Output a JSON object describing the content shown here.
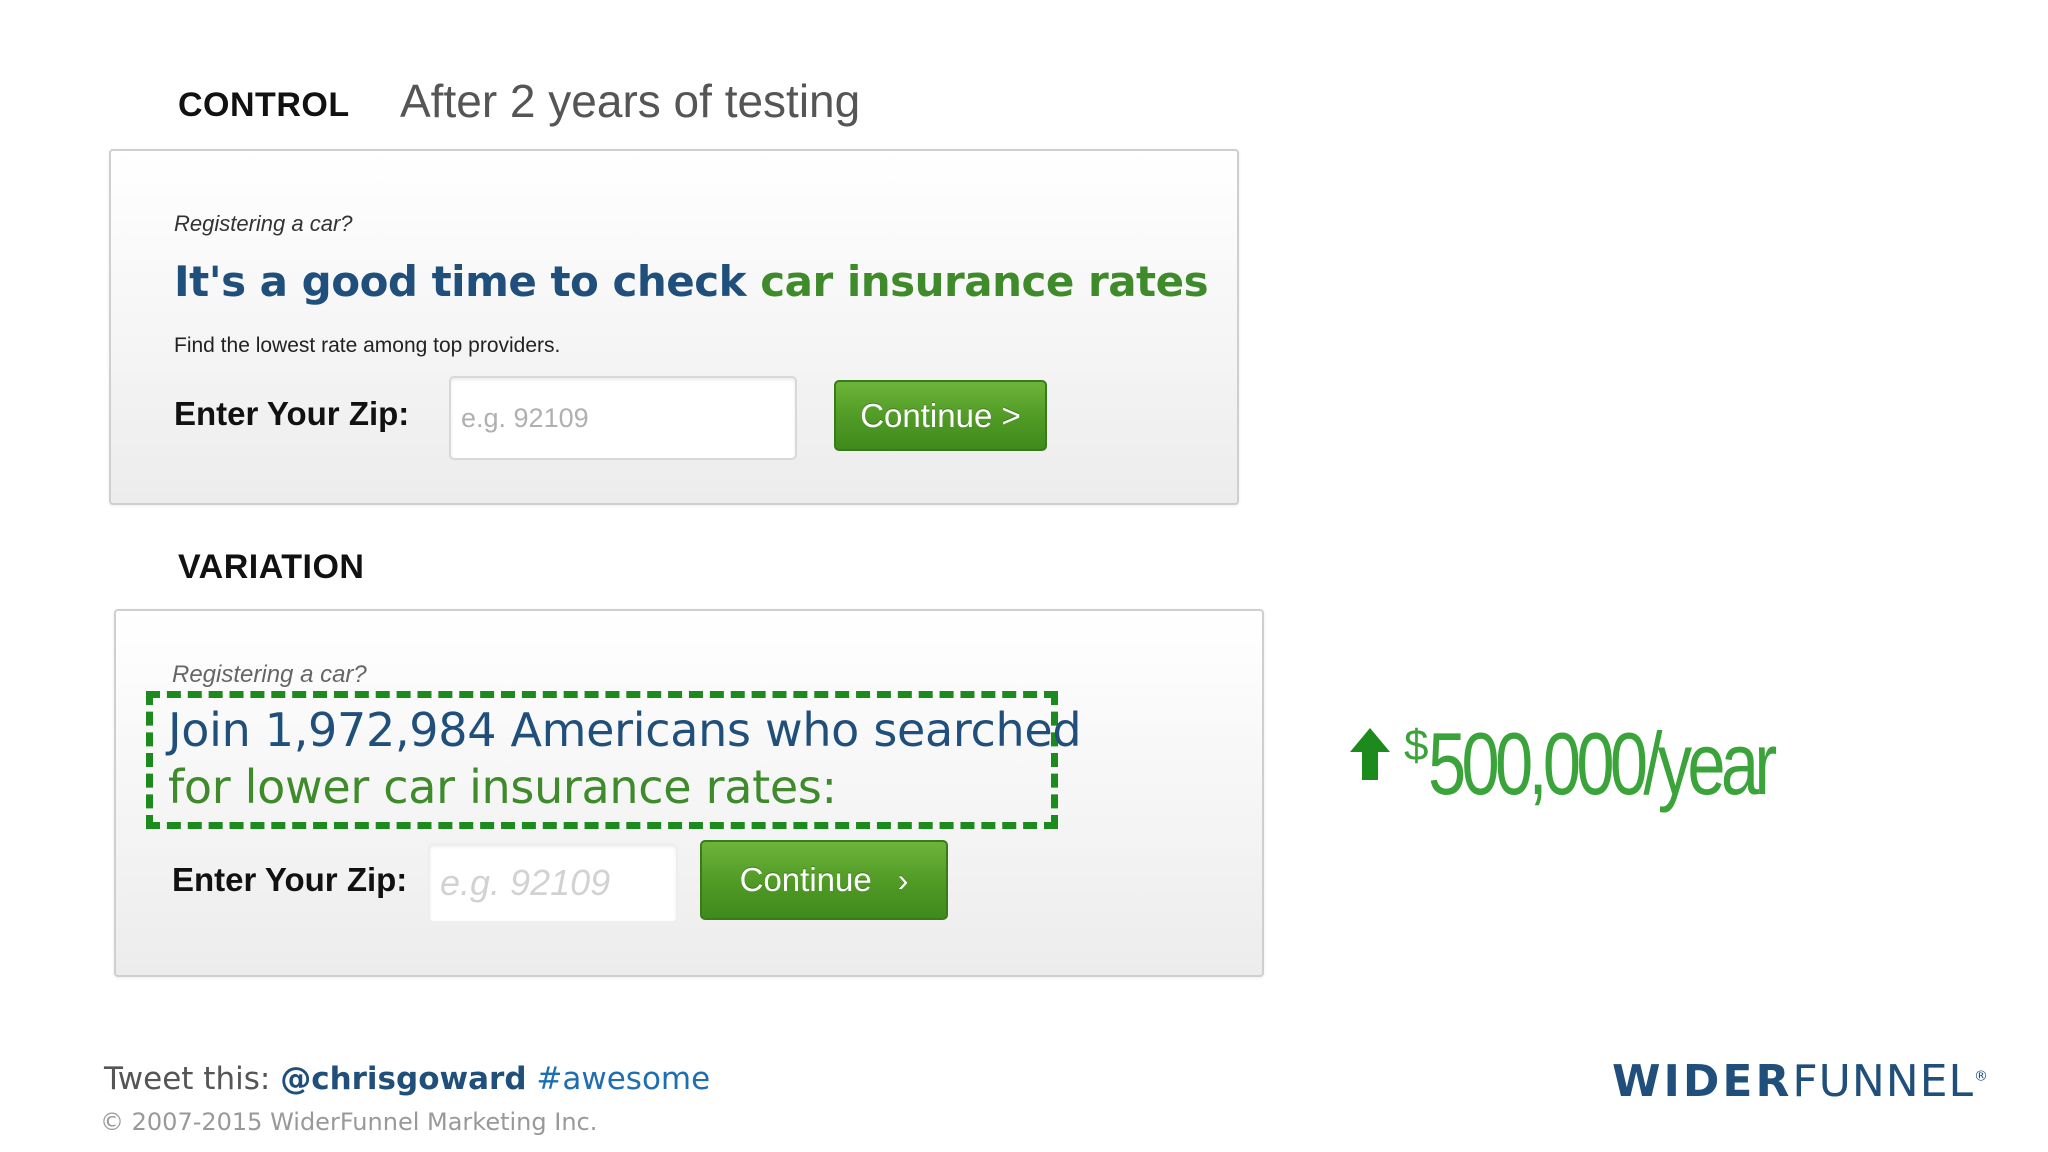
{
  "control": {
    "label": "CONTROL",
    "subtitle": "After 2 years of testing",
    "eyebrow": "Registering a car?",
    "headline_blue": "It's a good time to check",
    "headline_green": "car insurance rates",
    "subtext": "Find the lowest rate among top providers.",
    "zip_label": "Enter Your Zip:",
    "zip_placeholder": "e.g. 92109",
    "button_label": "Continue >"
  },
  "variation": {
    "label": "VARIATION",
    "eyebrow": "Registering a car?",
    "headline_line1": "Join 1,972,984 Americans who searched",
    "headline_line2": "for lower car insurance rates:",
    "zip_label": "Enter Your Zip:",
    "zip_placeholder": "e.g. 92109",
    "button_label": "Continue",
    "button_icon": "chevron-right-icon"
  },
  "result": {
    "icon": "arrow-up-icon",
    "currency": "$",
    "amount": "500,000/year"
  },
  "footer": {
    "tweet_prefix": "Tweet this:",
    "handle": "@chrisgoward",
    "hashtag": "#awesome",
    "copyright": "© 2007-2015 WiderFunnel Marketing Inc.",
    "logo_wider": "WIDER",
    "logo_funnel": "FUNNEL",
    "logo_mark": "®"
  },
  "colors": {
    "brand_blue": "#1f4f7a",
    "brand_green": "#3f8a2a",
    "result_green": "#3aa33a",
    "highlight_green": "#1d8a1d"
  }
}
